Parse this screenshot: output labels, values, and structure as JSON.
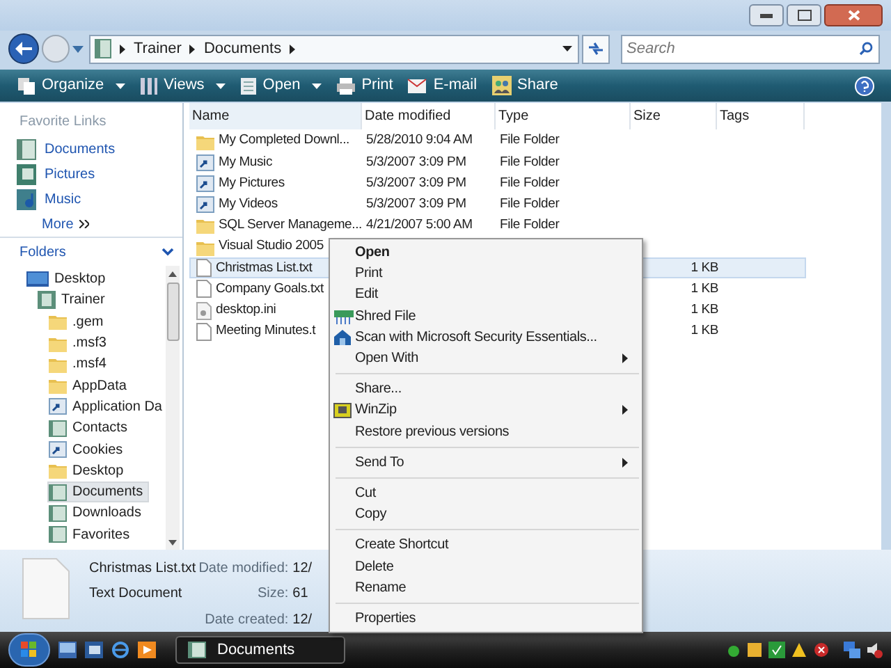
{
  "address": {
    "path": [
      "Trainer",
      "Documents"
    ]
  },
  "search": {
    "placeholder": "Search"
  },
  "toolbar": [
    {
      "label": "Organize",
      "dropdown": true
    },
    {
      "label": "Views",
      "dropdown": true
    },
    {
      "label": "Open",
      "dropdown": true
    },
    {
      "label": "Print",
      "dropdown": false
    },
    {
      "label": "E-mail",
      "dropdown": false
    },
    {
      "label": "Share",
      "dropdown": false
    }
  ],
  "favorite_links": {
    "title": "Favorite Links",
    "items": [
      "Documents",
      "Pictures",
      "Music"
    ],
    "more": "More"
  },
  "folders": {
    "title": "Folders",
    "tree": [
      {
        "label": "Desktop",
        "kind": "desktop",
        "selected": false,
        "children": [
          {
            "label": "Trainer",
            "kind": "user",
            "selected": false,
            "children": [
              {
                "label": ".gem",
                "kind": "folder",
                "selected": false
              },
              {
                "label": ".msf3",
                "kind": "folder",
                "selected": false
              },
              {
                "label": ".msf4",
                "kind": "folder",
                "selected": false
              },
              {
                "label": "AppData",
                "kind": "folder",
                "selected": false
              },
              {
                "label": "Application Da",
                "kind": "shortcut",
                "selected": false
              },
              {
                "label": "Contacts",
                "kind": "special",
                "selected": false
              },
              {
                "label": "Cookies",
                "kind": "shortcut",
                "selected": false
              },
              {
                "label": "Desktop",
                "kind": "folder",
                "selected": false
              },
              {
                "label": "Documents",
                "kind": "special",
                "selected": true
              },
              {
                "label": "Downloads",
                "kind": "special",
                "selected": false
              },
              {
                "label": "Favorites",
                "kind": "special",
                "selected": false
              }
            ]
          }
        ]
      }
    ]
  },
  "file_list": {
    "columns": [
      "Name",
      "Date modified",
      "Type",
      "Size",
      "Tags"
    ],
    "rows": [
      {
        "name": "My Completed Downl...",
        "date": "5/28/2010 9:04 AM",
        "type": "File Folder",
        "kind": "folder",
        "selected": false
      },
      {
        "name": "My Music",
        "date": "5/3/2007 3:09 PM",
        "type": "File Folder",
        "kind": "shortcut",
        "selected": false
      },
      {
        "name": "My Pictures",
        "date": "5/3/2007 3:09 PM",
        "type": "File Folder",
        "kind": "shortcut",
        "selected": false
      },
      {
        "name": "My Videos",
        "date": "5/3/2007 3:09 PM",
        "type": "File Folder",
        "kind": "shortcut",
        "selected": false
      },
      {
        "name": "SQL Server Manageme...",
        "date": "4/21/2007 5:00 AM",
        "type": "File Folder",
        "kind": "folder",
        "selected": false
      },
      {
        "name": "Visual Studio 2005",
        "kind": "folder",
        "selected": false
      },
      {
        "name": "Christmas List.txt",
        "size": "1 KB",
        "kind": "file",
        "selected": true
      },
      {
        "name": "Company Goals.txt",
        "size": "1 KB",
        "kind": "file",
        "selected": false
      },
      {
        "name": "desktop.ini",
        "size": "1 KB",
        "kind": "ini",
        "selected": false
      },
      {
        "name": "Meeting Minutes.t",
        "size": "1 KB",
        "kind": "file",
        "selected": false
      }
    ]
  },
  "details": {
    "name": "Christmas List.txt",
    "type": "Text Document",
    "fields": [
      {
        "label": "Date modified:",
        "value": "12/"
      },
      {
        "label": "Size:",
        "value": "61"
      },
      {
        "label": "Date created:",
        "value": "12/"
      }
    ]
  },
  "context_menu": [
    {
      "kind": "plain",
      "label": "Open",
      "default": true,
      "submenu": false
    },
    {
      "kind": "plain",
      "label": "Print",
      "default": false,
      "submenu": false
    },
    {
      "kind": "plain",
      "label": "Edit",
      "default": false,
      "submenu": false
    },
    {
      "kind": "shred",
      "label": "Shred File",
      "default": false,
      "submenu": false
    },
    {
      "kind": "scan",
      "label": "Scan with Microsoft Security Essentials...",
      "default": false,
      "submenu": false
    },
    {
      "kind": "plain",
      "label": "Open With",
      "default": false,
      "submenu": true
    },
    {
      "kind": "separator"
    },
    {
      "kind": "plain",
      "label": "Share...",
      "default": false,
      "submenu": false
    },
    {
      "kind": "zip",
      "label": "WinZip",
      "default": false,
      "submenu": true
    },
    {
      "kind": "plain",
      "label": "Restore previous versions",
      "default": false,
      "submenu": false
    },
    {
      "kind": "separator"
    },
    {
      "kind": "plain",
      "label": "Send To",
      "default": false,
      "submenu": true
    },
    {
      "kind": "separator"
    },
    {
      "kind": "plain",
      "label": "Cut",
      "default": false,
      "submenu": false
    },
    {
      "kind": "plain",
      "label": "Copy",
      "default": false,
      "submenu": false
    },
    {
      "kind": "separator"
    },
    {
      "kind": "plain",
      "label": "Create Shortcut",
      "default": false,
      "submenu": false
    },
    {
      "kind": "plain",
      "label": "Delete",
      "default": false,
      "submenu": false
    },
    {
      "kind": "plain",
      "label": "Rename",
      "default": false,
      "submenu": false
    },
    {
      "kind": "separator"
    },
    {
      "kind": "plain",
      "label": "Properties",
      "default": false,
      "submenu": false
    }
  ],
  "taskbar": {
    "tasks": [
      {
        "label": "Documents",
        "selected": true
      }
    ]
  }
}
